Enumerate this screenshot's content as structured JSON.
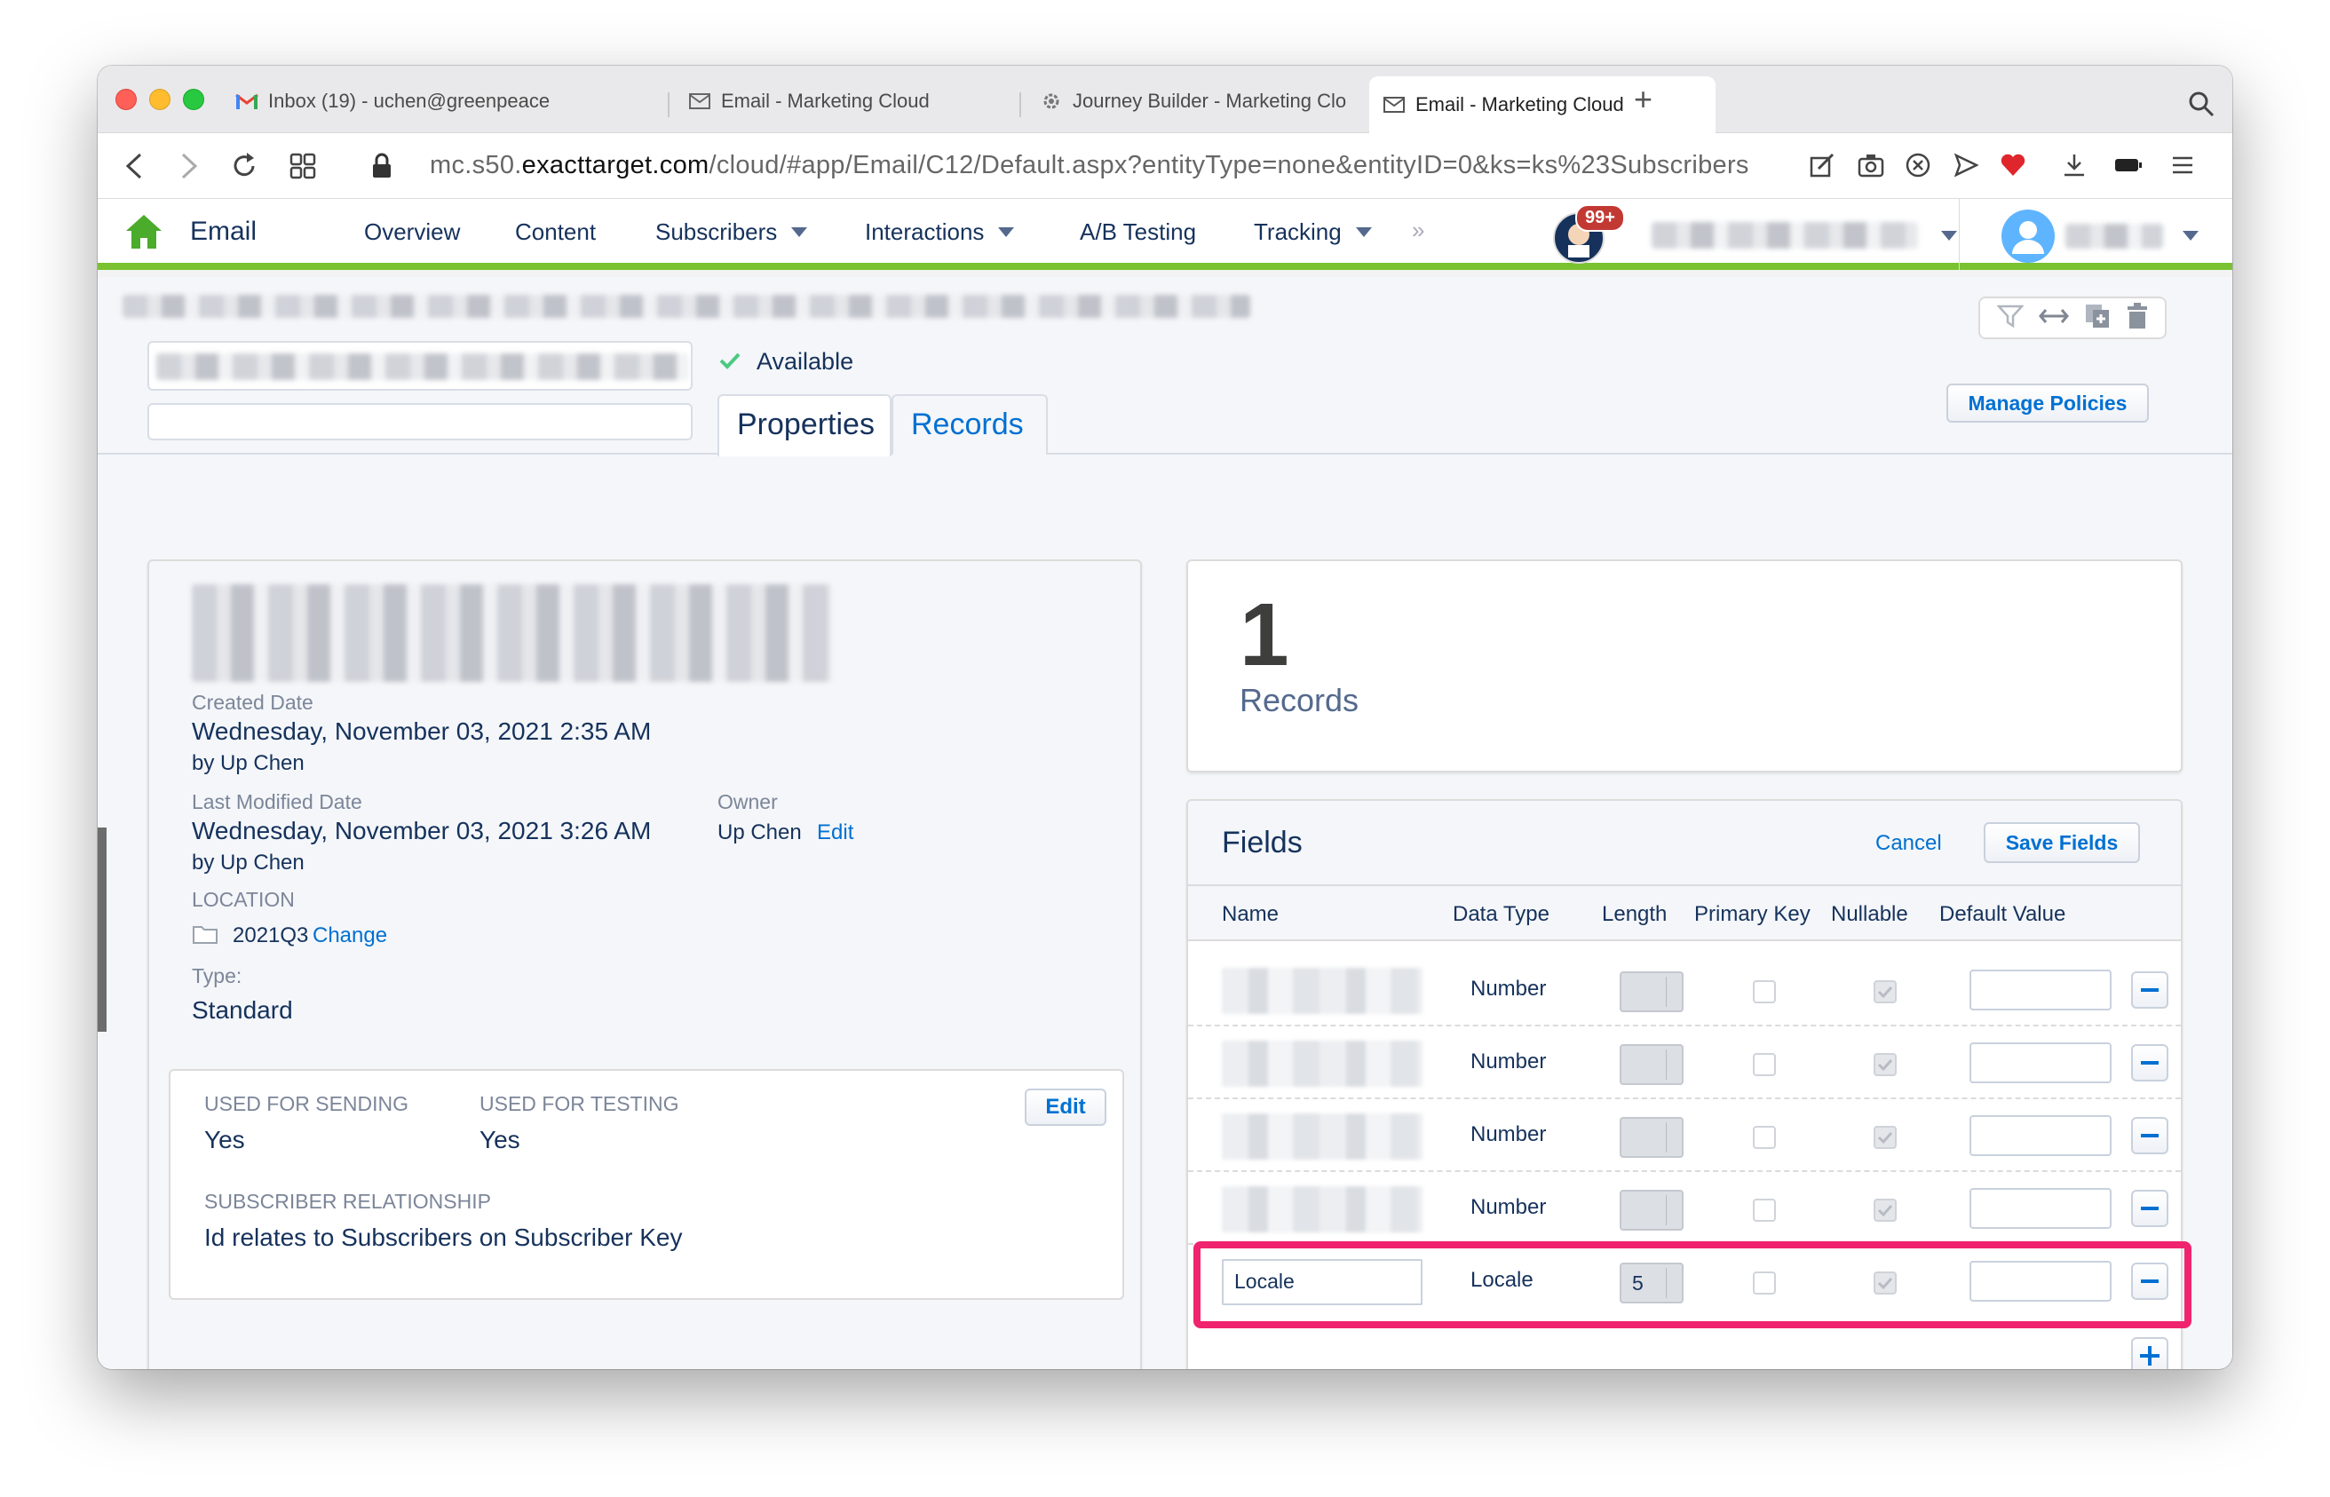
{
  "browser": {
    "tabs": [
      {
        "label": "Inbox (19) - uchen@greenpeace",
        "icon": "gmail-icon"
      },
      {
        "label": "Email - Marketing Cloud",
        "icon": "envelope-icon"
      },
      {
        "label": "Journey Builder - Marketing Clo",
        "icon": "gear-icon"
      },
      {
        "label": "Email - Marketing Cloud",
        "icon": "envelope-icon",
        "active": true
      }
    ],
    "url_prefix": "mc.s50.",
    "url_domain": "exacttarget.com",
    "url_path": "/cloud/#app/Email/C12/Default.aspx?entityType=none&entityID=0&ks=ks%23Subscribers"
  },
  "app": {
    "name": "Email",
    "menu": [
      {
        "label": "Overview",
        "dropdown": false
      },
      {
        "label": "Content",
        "dropdown": false
      },
      {
        "label": "Subscribers",
        "dropdown": true
      },
      {
        "label": "Interactions",
        "dropdown": true
      },
      {
        "label": "A/B Testing",
        "dropdown": false
      },
      {
        "label": "Tracking",
        "dropdown": true
      }
    ],
    "more": "»",
    "notification_count": "99+",
    "accent_color": "#7ac231"
  },
  "header_area": {
    "status": "Available",
    "tabs": {
      "properties": "Properties",
      "records": "Records"
    },
    "manage_policies": "Manage Policies"
  },
  "properties": {
    "created_label": "Created Date",
    "created_value": "Wednesday, November 03, 2021 2:35 AM",
    "created_by": "by Up Chen",
    "modified_label": "Last Modified Date",
    "modified_value": "Wednesday, November 03, 2021 3:26 AM",
    "modified_by": "by Up Chen",
    "owner_label": "Owner",
    "owner_value": "Up Chen",
    "owner_edit": "Edit",
    "location_label": "LOCATION",
    "location_value": "2021Q3",
    "location_change": "Change",
    "type_label": "Type:",
    "type_value": "Standard",
    "sending_label": "USED FOR SENDING",
    "sending_value": "Yes",
    "testing_label": "USED FOR TESTING",
    "testing_value": "Yes",
    "edit_label": "Edit",
    "relationship_label": "SUBSCRIBER RELATIONSHIP",
    "relationship_value": "Id relates to Subscribers on Subscriber Key"
  },
  "records": {
    "count": "1",
    "label": "Records"
  },
  "fields": {
    "title": "Fields",
    "cancel": "Cancel",
    "save": "Save Fields",
    "columns": [
      "Name",
      "Data Type",
      "Length",
      "Primary Key",
      "Nullable",
      "Default Value"
    ],
    "rows": [
      {
        "name": "",
        "type": "Number",
        "length": "",
        "nullable": true
      },
      {
        "name": "",
        "type": "Number",
        "length": "",
        "nullable": true
      },
      {
        "name": "",
        "type": "Number",
        "length": "",
        "nullable": true
      },
      {
        "name": "",
        "type": "Number",
        "length": "",
        "nullable": true
      },
      {
        "name": "Locale",
        "type": "Locale",
        "length": "5",
        "nullable": true
      }
    ],
    "highlight_color": "#f0246e"
  }
}
